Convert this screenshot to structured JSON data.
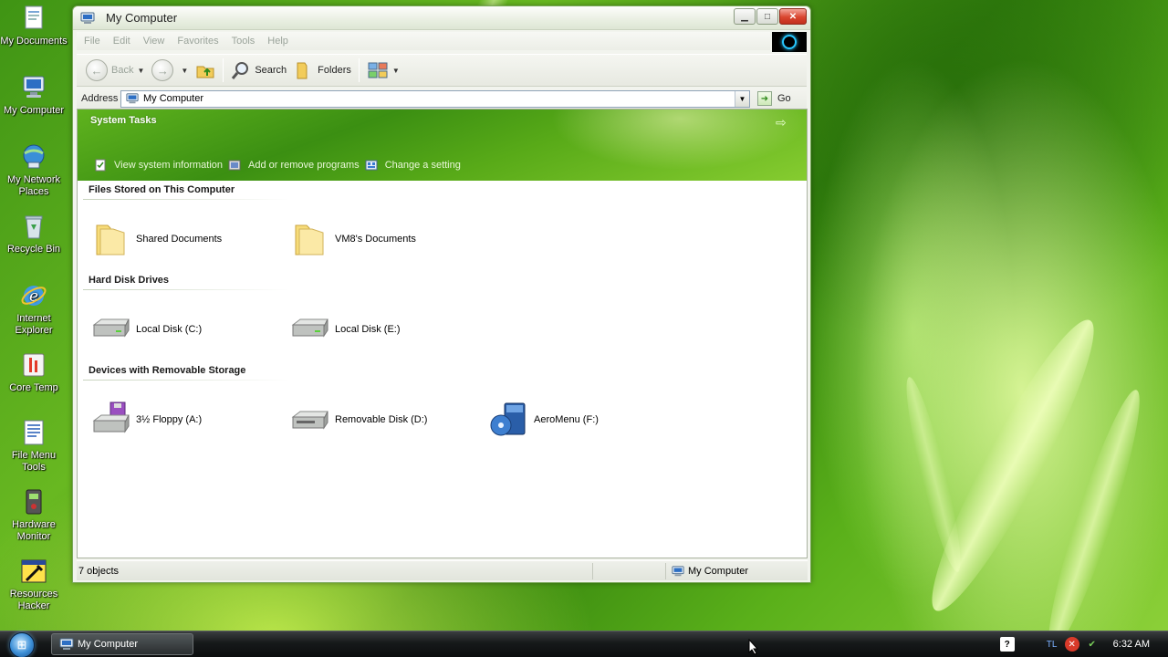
{
  "desktop": {
    "icons": [
      {
        "label": "My Documents",
        "icon": "my-documents-icon"
      },
      {
        "label": "My Computer",
        "icon": "my-computer-icon"
      },
      {
        "label": "My Network Places",
        "icon": "network-places-icon"
      },
      {
        "label": "Recycle Bin",
        "icon": "recycle-bin-icon"
      },
      {
        "label": "Internet Explorer",
        "icon": "internet-explorer-icon"
      },
      {
        "label": "Core Temp",
        "icon": "core-temp-icon"
      },
      {
        "label": "File Menu Tools",
        "icon": "file-menu-tools-icon"
      },
      {
        "label": "Hardware Monitor",
        "icon": "hardware-monitor-icon"
      },
      {
        "label": "Resources Hacker",
        "icon": "resources-hacker-icon"
      }
    ]
  },
  "window": {
    "title": "My Computer",
    "menu": [
      "File",
      "Edit",
      "View",
      "Favorites",
      "Tools",
      "Help"
    ],
    "toolbar": {
      "back_label": "Back",
      "search_label": "Search",
      "folders_label": "Folders"
    },
    "address": {
      "label": "Address",
      "value": "My Computer",
      "go_label": "Go"
    },
    "system_tasks": {
      "title": "System Tasks",
      "links": [
        "View system information",
        "Add or remove programs",
        "Change a setting"
      ]
    },
    "groups": [
      {
        "title": "Files Stored on This Computer",
        "items": [
          {
            "label": "Shared Documents",
            "icon": "folder-icon"
          },
          {
            "label": "VM8's Documents",
            "icon": "folder-icon"
          }
        ]
      },
      {
        "title": "Hard Disk Drives",
        "items": [
          {
            "label": "Local Disk (C:)",
            "icon": "hard-disk-icon"
          },
          {
            "label": "Local Disk (E:)",
            "icon": "hard-disk-icon"
          }
        ]
      },
      {
        "title": "Devices with Removable Storage",
        "items": [
          {
            "label": "3½ Floppy (A:)",
            "icon": "floppy-drive-icon"
          },
          {
            "label": "Removable Disk (D:)",
            "icon": "removable-disk-icon"
          },
          {
            "label": "AeroMenu (F:)",
            "icon": "cd-drive-icon"
          }
        ]
      }
    ],
    "status": {
      "objects": "7 objects",
      "location": "My Computer"
    }
  },
  "taskbar": {
    "active_task": "My Computer",
    "clock": "6:32 AM"
  },
  "colors": {
    "tasks_panel": "#4a9c18",
    "taskbar": "#16191a",
    "close_button": "#d9452f"
  }
}
